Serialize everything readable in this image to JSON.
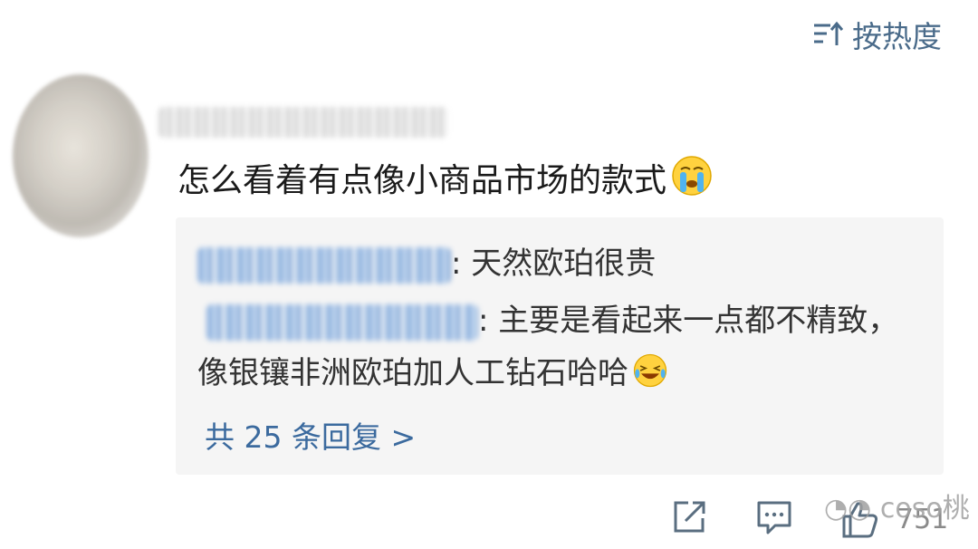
{
  "header": {
    "sort_label": "按热度",
    "sort_icon": "sort-icon"
  },
  "comment": {
    "text": "怎么看着有点像小商品市场的款式",
    "emoji": "crying-face-emoji"
  },
  "replies": [
    {
      "text": ": 天然欧珀很贵"
    },
    {
      "text": ": 主要是看起来一点都不精致，像银镶非洲欧珀加人工钻石哈哈",
      "emoji": "laughing-face-emoji"
    }
  ],
  "more_replies_label": "共 25 条回复 >",
  "actions": {
    "share_icon": "share-icon",
    "comment_icon": "comment-icon",
    "like_icon": "like-icon",
    "like_count": "751"
  },
  "watermark": "coso桃",
  "colors": {
    "link": "#3b6a9e",
    "reply_bg": "#f5f5f5",
    "icon": "#5a6e80"
  }
}
